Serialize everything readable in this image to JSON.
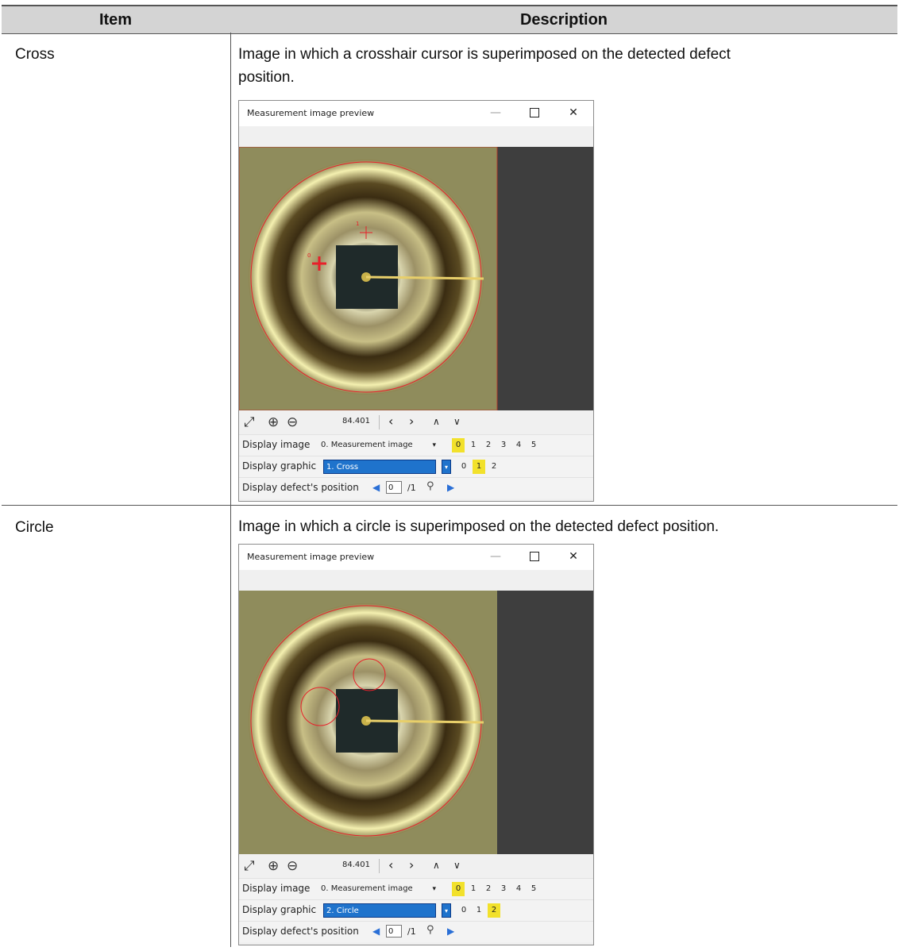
{
  "table": {
    "headers": {
      "item": "Item",
      "description": "Description"
    },
    "rows": [
      {
        "item": "Cross",
        "description_line1": "Image in which a crosshair cursor is superimposed on the detected defect",
        "description_line2": "position."
      },
      {
        "item": "Circle",
        "description_line1": "Image in which a circle is superimposed on the detected defect position."
      }
    ]
  },
  "windows": [
    {
      "title": "Measurement image preview",
      "zoom": "84.401",
      "display_image_label": "Display image",
      "display_image_value": "0. Measurement image",
      "display_image_options": [
        "0",
        "1",
        "2",
        "3",
        "4",
        "5"
      ],
      "display_image_selected": "0",
      "display_graphic_label": "Display graphic",
      "display_graphic_value": "1. Cross",
      "display_graphic_options": [
        "0",
        "1",
        "2"
      ],
      "display_graphic_selected": "1",
      "defect_position_label": "Display defect's position",
      "defect_position_value": "0",
      "defect_position_total": "/1",
      "marker_labels": [
        "1",
        "0"
      ]
    },
    {
      "title": "Measurement image preview",
      "zoom": "84.401",
      "display_image_label": "Display image",
      "display_image_value": "0. Measurement image",
      "display_image_options": [
        "0",
        "1",
        "2",
        "3",
        "4",
        "5"
      ],
      "display_image_selected": "0",
      "display_graphic_label": "Display graphic",
      "display_graphic_value": "2. Circle",
      "display_graphic_options": [
        "0",
        "1",
        "2"
      ],
      "display_graphic_selected": "2",
      "defect_position_label": "Display defect's position",
      "defect_position_value": "0",
      "defect_position_total": "/1"
    }
  ],
  "colors": {
    "header_bg": "#d4d4d4",
    "highlight": "#f2e12b",
    "overlay_red": "#e8202a",
    "selection_blue": "#1f73cc"
  },
  "icons": [
    "fit-screen-icon",
    "zoom-in-icon",
    "zoom-out-icon",
    "prev-icon",
    "next-icon",
    "up-icon",
    "down-icon",
    "search-icon",
    "minimize-icon",
    "maximize-icon",
    "close-icon"
  ]
}
